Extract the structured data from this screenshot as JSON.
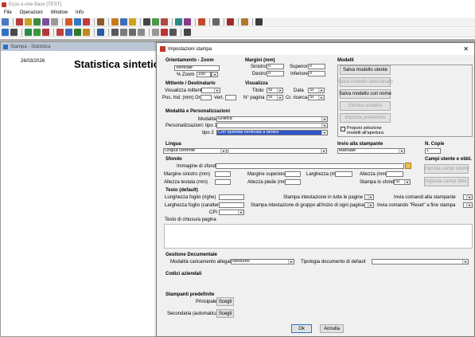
{
  "app": {
    "title": "Ecos e-one Base [TEST]"
  },
  "menu": [
    "File",
    "Operazioni",
    "Window",
    "Info"
  ],
  "child": {
    "title": "Stampa - Statistica",
    "date": "26/03/2026",
    "heading": "Statistica sintetica"
  },
  "dialog": {
    "title": "Impostazioni stampa",
    "orient": {
      "title": "Orientamento - Zoom",
      "value": "Verticale",
      "zoom_label": "% Zoom",
      "zoom_value": "100"
    },
    "margini": {
      "title": "Margini (mm)",
      "sinistro_label": "Sinistro",
      "sinistro": "0",
      "destro_label": "Destro",
      "destro": "0",
      "superiore_label": "Superiore",
      "superiore": "0",
      "inferiore_label": "Inferiore",
      "inferiore": "0"
    },
    "mittente": {
      "title": "Mittente / Destinatario",
      "vis_label": "Visualizza mittente",
      "pos_label": "Pos. Ind. (mm) Oriz.",
      "vert_label": "Vert."
    },
    "visualizza": {
      "title": "Visualizza",
      "titolo_label": "Titolo",
      "titolo": "Si",
      "data_label": "Data",
      "data": "Si",
      "npagina_label": "N° pagina",
      "npagina": "Si",
      "crricerca_label": "Cr. ricerca",
      "crricerca": "Si"
    },
    "modelli": {
      "title": "Modelli",
      "save_user": "Salva modello utente",
      "save_selected": "Salva modello selezionato",
      "save_name": "Salva modello con nome",
      "delete": "Elimina modello",
      "default": "Imposta predefinito"
    },
    "modalita": {
      "title": "Modalità e Personalizzazioni",
      "modalita_label": "Modalità",
      "modalita": "Grafica",
      "tipo1_label": "Personalizzazioni: tipo 1",
      "tipo1": "",
      "tipo2_label": "tipo 2",
      "tipo2": "Con quantità verificata a destra",
      "proponi": "Proponi selezione modelli all'apertura"
    },
    "lingua": {
      "title": "Lingua",
      "value": "Lingua corrente"
    },
    "invio": {
      "title": "Invio alla stampante",
      "value": "Manuale"
    },
    "ncopie": {
      "title": "N. Copie",
      "value": "1"
    },
    "sfondo": {
      "title": "Sfondo",
      "immagine_label": "Immagine di sfondo",
      "margine_sx_label": "Margine sinistro (mm)",
      "margine_sup_label": "Margine superiore (mm)",
      "larghezza_label": "Larghezza (mm)",
      "altezza_label": "Altezza (mm)",
      "altezza_testata_label": "Altezza testata (mm)",
      "altezza_piede_label": "Altezza piede (mm)",
      "stampa_sfondo_label": "Stampa lo sfondo",
      "stampa_sfondo": "Si"
    },
    "campi": {
      "title": "Campi utente e obbl.",
      "set_user": "Imposta campi utente",
      "set_required": "Imposta campi obbl."
    },
    "testo": {
      "title": "Testo (default)",
      "lunghezza_label": "Lunghezza foglio (righe)",
      "larghezza_label": "Larghezza foglio (caratteri)",
      "cpi_label": "CPI",
      "intestazione_label": "Stampa intestazione in tutte le pagine",
      "intestazione_gruppo_label": "Stampa intestazione di gruppo all'inizio di ogni pagina",
      "invio_comandi_label": "Invia comandi alla stampante",
      "invio_reset_label": "Invia comando \"Reset\" a fine stampa",
      "chiusura_label": "Testo di chiusura pagina"
    },
    "gestione": {
      "title": "Gestione Documentale",
      "modalita_label": "Modalità caricamento allegato",
      "modalita": "Nessuno",
      "tipologia_label": "Tipologia documento di default"
    },
    "codici": {
      "title": "Codici aziendali"
    },
    "stampanti": {
      "title": "Stampanti predefinite",
      "principale_label": "Principale",
      "secondaria_label": "Secondaria (automatica)",
      "scegli": "Scegli"
    },
    "ok": "Ok",
    "annulla": "Annulla"
  }
}
